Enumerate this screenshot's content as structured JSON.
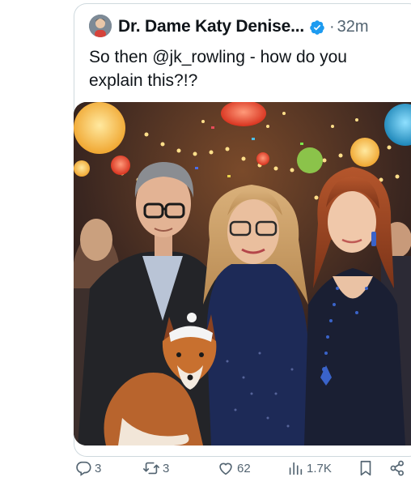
{
  "tweet": {
    "author_name": "Dr. Dame Katy Denise...",
    "dot": "·",
    "timestamp": "32m",
    "text": "So then @jk_rowling - how do you explain this?!?"
  },
  "actions": {
    "replies": "3",
    "reposts": "3",
    "likes": "62",
    "views": "1.7K"
  },
  "icons": {
    "verified": "verified-badge-icon",
    "reply": "reply-icon",
    "repost": "repost-icon",
    "like": "heart-icon",
    "views": "views-icon",
    "bookmark": "bookmark-icon",
    "share": "share-icon"
  },
  "colors": {
    "text": "#0f1419",
    "muted": "#536471",
    "verified": "#1d9bf0",
    "border": "#cfd9de"
  }
}
